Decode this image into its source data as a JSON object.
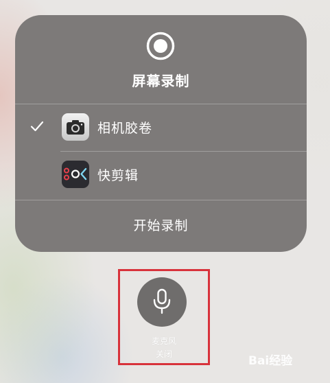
{
  "panel": {
    "title": "屏幕录制",
    "icon": "record-icon",
    "options": [
      {
        "label": "相机胶卷",
        "icon": "camera-app-icon",
        "selected": true
      },
      {
        "label": "快剪辑",
        "icon": "kuaijianji-app-icon",
        "selected": false
      }
    ],
    "start_label": "开始录制"
  },
  "microphone": {
    "icon": "microphone-icon",
    "label_line1": "麦克风",
    "label_line2": "关闭"
  },
  "highlight_color": "#d8323b",
  "watermark": {
    "text": "Bai经验"
  }
}
